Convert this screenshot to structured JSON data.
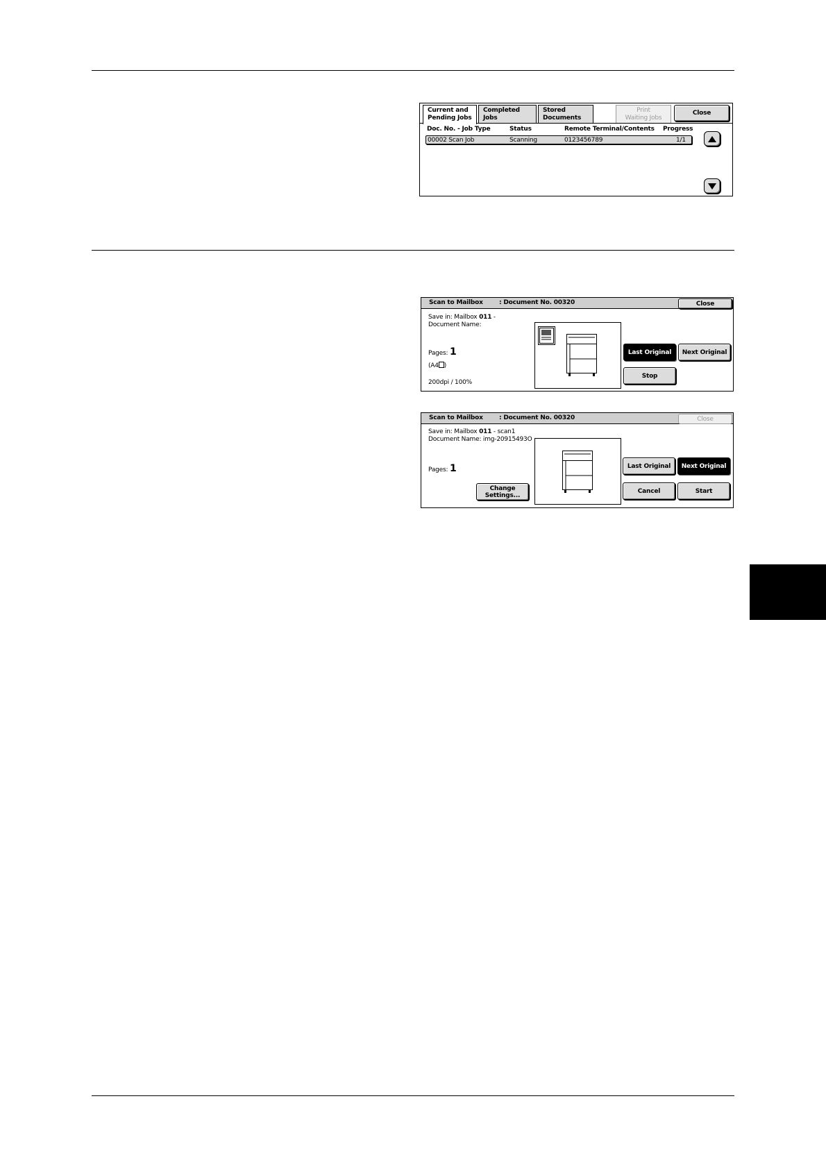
{
  "job_status": {
    "tabs": [
      {
        "label_line1": "Current and",
        "label_line2": "Pending Jobs"
      },
      {
        "label_line1": "Completed Jobs",
        "label_line2": ""
      },
      {
        "label_line1": "Stored",
        "label_line2": "Documents"
      },
      {
        "label_line1": "Print",
        "label_line2": "Waiting Jobs"
      }
    ],
    "close_label": "Close",
    "columns": [
      "Doc. No. - Job Type",
      "Status",
      "Remote Terminal/Contents",
      "Progress"
    ],
    "rows": [
      {
        "doc_job": "00002  Scan Job",
        "status": "Scanning",
        "remote": "0123456789",
        "progress": "1/1"
      }
    ]
  },
  "scan_panel_1": {
    "title": "Scan to Mailbox",
    "doc_number": ": Document No. 00320",
    "close_label": "Close",
    "save_in": "Save in: Mailbox",
    "mailbox_no": "011",
    "mailbox_suffix": " -",
    "document_name": "Document Name:",
    "pages_label": "Pages:",
    "pages_value": "1",
    "paper": "(A4",
    "paper_end": ")",
    "resolution": "200dpi / 100%",
    "buttons": {
      "last": "Last Original",
      "next": "Next Original",
      "stop": "Stop"
    }
  },
  "scan_panel_2": {
    "title": "Scan to Mailbox",
    "doc_number": ": Document No. 00320",
    "close_label": "Close",
    "save_in": "Save in: Mailbox",
    "mailbox_no": "011",
    "mailbox_suffix": " - scan1",
    "document_name": "Document Name: img-20915493O",
    "pages_label": "Pages:",
    "pages_value": "1",
    "change_line1": "Change",
    "change_line2": "Settings...",
    "buttons": {
      "last": "Last Original",
      "next": "Next Original",
      "cancel": "Cancel",
      "start": "Start"
    }
  }
}
